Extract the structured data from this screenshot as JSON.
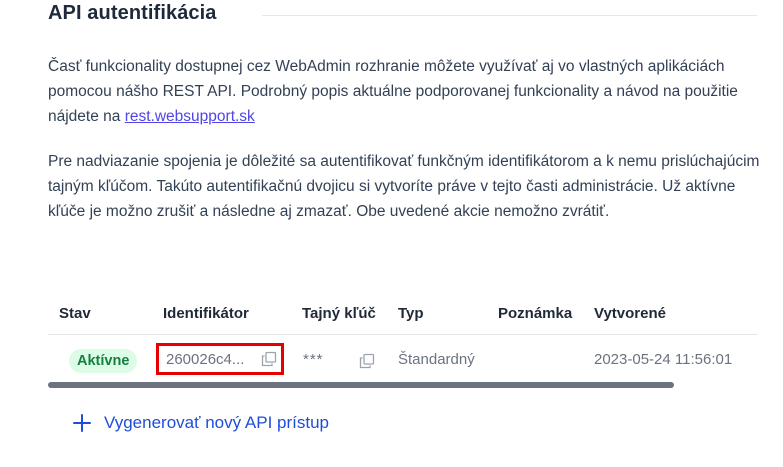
{
  "section": {
    "title": "API autentifikácia"
  },
  "intro": {
    "p1_before_link": "Časť funkcionality dostupnej cez WebAdmin rozhranie môžete využívať aj vo vlastných aplikáciách pomocou nášho REST API. Podrobný popis aktuálne podporovanej funkcionality a návod na použitie nájdete na ",
    "p1_link": "rest.websupport.sk",
    "p2": "Pre nadviazanie spojenia je dôležité sa autentifikovať funkčným identifikátorom a k nemu prislúchajúcim tajným kľúčom. Takúto autentifikačnú dvojicu si vytvoríte práve v tejto časti administrácie. Už aktívne kľúče je možno zrušiť a následne aj zmazať. Obe uvedené akcie nemožno zvrátiť."
  },
  "table": {
    "headers": {
      "status": "Stav",
      "identifier": "Identifikátor",
      "secret": "Tajný kľúč",
      "type": "Typ",
      "note": "Poznámka",
      "created": "Vytvorené"
    },
    "rows": [
      {
        "status": "Aktívne",
        "identifier": "260026c4...",
        "secret": "***",
        "type": "Štandardný",
        "note": "",
        "created": "2023-05-24 11:56:01"
      }
    ]
  },
  "actions": {
    "add_label": "Vygenerovať nový API prístup"
  },
  "colors": {
    "accent": "#1d4ed8",
    "badge_bg": "#dcfce7",
    "badge_text": "#15803d",
    "highlight_border": "#e60000"
  },
  "icons": [
    "copy-icon",
    "copy-icon",
    "plus-icon"
  ]
}
